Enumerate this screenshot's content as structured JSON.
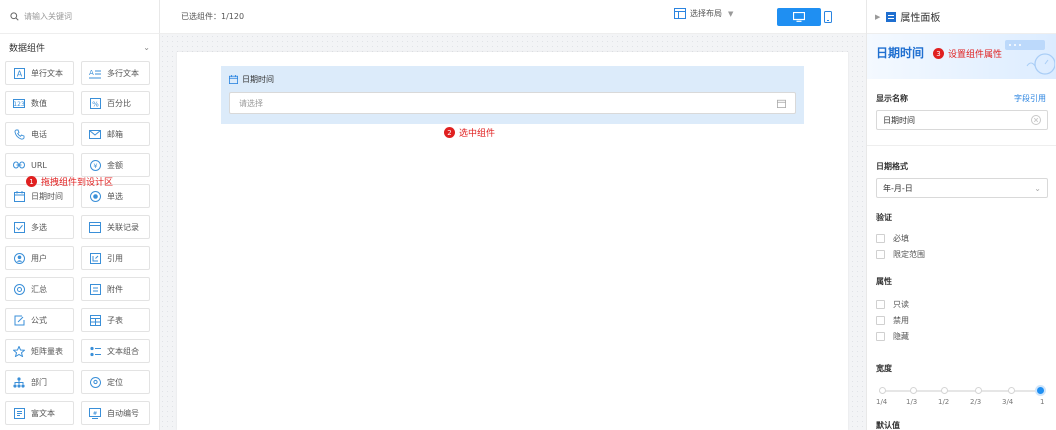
{
  "search": {
    "placeholder": "请输入关键词"
  },
  "left_panel": {
    "group_title": "数据组件",
    "components": [
      {
        "label": "单行文本",
        "icon": "text-icon"
      },
      {
        "label": "多行文本",
        "icon": "multiline-text-icon"
      },
      {
        "label": "数值",
        "icon": "number-icon"
      },
      {
        "label": "百分比",
        "icon": "percent-icon"
      },
      {
        "label": "电话",
        "icon": "phone-icon"
      },
      {
        "label": "邮箱",
        "icon": "mail-icon"
      },
      {
        "label": "URL",
        "icon": "link-icon"
      },
      {
        "label": "金额",
        "icon": "money-icon"
      },
      {
        "label": "日期时间",
        "icon": "calendar-icon"
      },
      {
        "label": "单选",
        "icon": "radio-icon"
      },
      {
        "label": "多选",
        "icon": "checkbox-icon"
      },
      {
        "label": "关联记录",
        "icon": "relation-icon"
      },
      {
        "label": "用户",
        "icon": "user-icon"
      },
      {
        "label": "引用",
        "icon": "reference-icon"
      },
      {
        "label": "汇总",
        "icon": "summary-icon"
      },
      {
        "label": "附件",
        "icon": "attachment-icon"
      },
      {
        "label": "公式",
        "icon": "formula-icon"
      },
      {
        "label": "子表",
        "icon": "subtable-icon"
      },
      {
        "label": "矩阵量表",
        "icon": "matrix-icon"
      },
      {
        "label": "文本组合",
        "icon": "text-combo-icon"
      },
      {
        "label": "部门",
        "icon": "department-icon"
      },
      {
        "label": "定位",
        "icon": "location-icon"
      },
      {
        "label": "富文本",
        "icon": "rich-text-icon"
      },
      {
        "label": "自动编号",
        "icon": "auto-number-icon"
      }
    ]
  },
  "toolbar": {
    "selected_count": "已选组件：1/120",
    "layout_label": "选择布局",
    "layout_icon": "layout-icon",
    "desktop_icon": "desktop-icon",
    "mobile_icon": "mobile-icon",
    "accent": "#1f8ff2"
  },
  "canvas": {
    "field_label": "日期时间",
    "field_placeholder": "请选择"
  },
  "annotations": [
    {
      "num": "1",
      "text": "拖拽组件到设计区"
    },
    {
      "num": "2",
      "text": "选中组件"
    },
    {
      "num": "3",
      "text": "设置组件属性"
    }
  ],
  "annotation_color": "#e02020",
  "right_panel": {
    "header": "属性面板",
    "component_title": "日期时间",
    "display_name_label": "显示名称",
    "field_ref_link": "字段引用",
    "display_name_value": "日期时间",
    "date_format_label": "日期格式",
    "date_format_value": "年-月-日",
    "validation_label": "验证",
    "validation_options": [
      "必填",
      "限定范围"
    ],
    "attributes_label": "属性",
    "attribute_options": [
      "只读",
      "禁用",
      "隐藏"
    ],
    "width_label": "宽度",
    "width_ticks": [
      "1/4",
      "1/3",
      "1/2",
      "2/3",
      "3/4",
      "1"
    ],
    "width_selected": "1",
    "default_value_label": "默认值"
  }
}
